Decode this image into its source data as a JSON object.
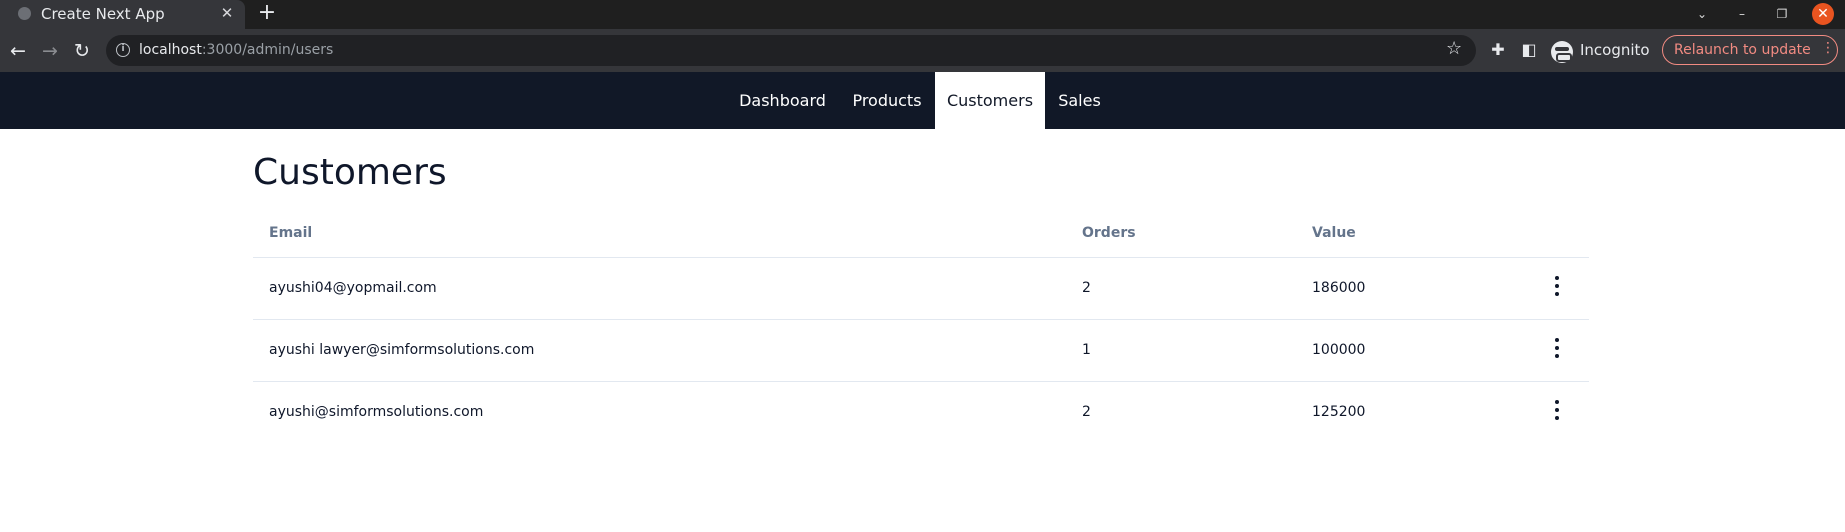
{
  "browser": {
    "tab_title": "Create Next App",
    "url_host": "localhost",
    "url_path": ":3000/admin/users",
    "profile_label": "Incognito",
    "relaunch_label": "Relaunch to update"
  },
  "nav": {
    "items": [
      {
        "label": "Dashboard",
        "active": false
      },
      {
        "label": "Products",
        "active": false
      },
      {
        "label": "Customers",
        "active": true
      },
      {
        "label": "Sales",
        "active": false
      }
    ]
  },
  "page": {
    "title": "Customers"
  },
  "table": {
    "headers": {
      "email": "Email",
      "orders": "Orders",
      "value": "Value"
    },
    "rows": [
      {
        "email": "ayushi04@yopmail.com",
        "orders": "2",
        "value": "186000"
      },
      {
        "email": "ayushi lawyer@simformsolutions.com",
        "orders": "1",
        "value": "100000"
      },
      {
        "email": "ayushi@simformsolutions.com",
        "orders": "2",
        "value": "125200"
      }
    ]
  }
}
